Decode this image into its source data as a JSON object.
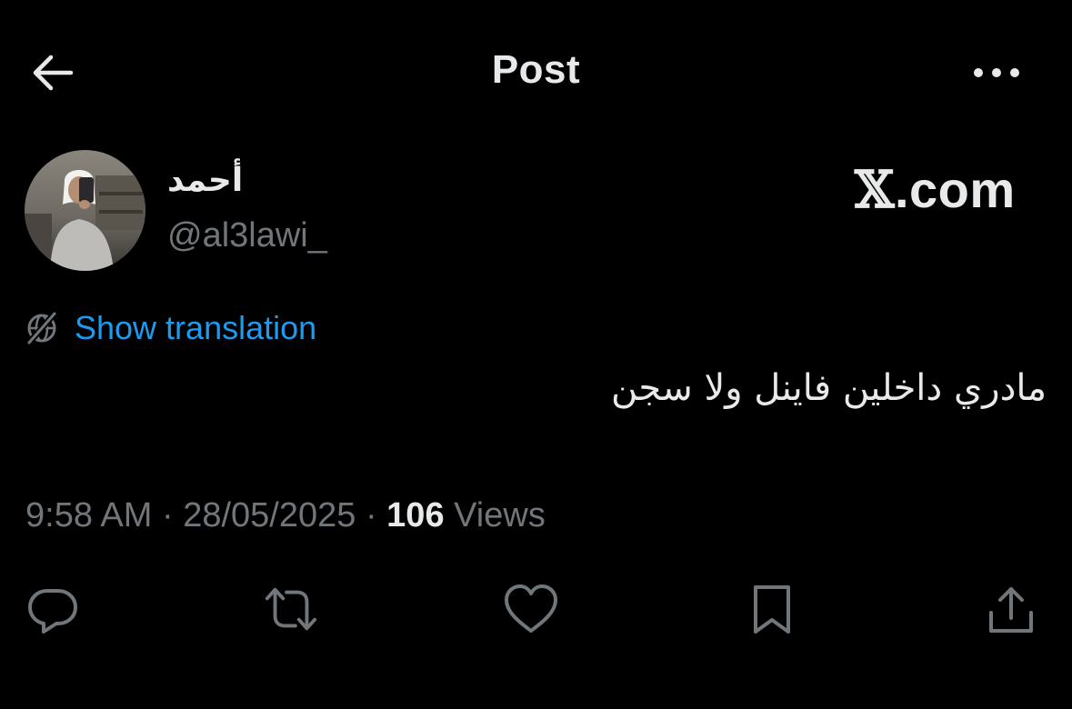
{
  "header": {
    "title": "Post",
    "back_icon": "arrow-left-icon",
    "more_icon": "ellipsis-icon"
  },
  "author": {
    "display_name": "أحمد",
    "handle": "@al3lawi_",
    "avatar": "profile-photo"
  },
  "watermark": {
    "x_letter": "𝕏",
    "domain": ".com"
  },
  "translation": {
    "label": "Show translation",
    "icon": "globe-slash-icon"
  },
  "post": {
    "text": "مادري داخلين فاينل ولا سجن"
  },
  "meta": {
    "time": "9:58 AM",
    "separator": " · ",
    "date": "28/05/2025",
    "views_count": "106",
    "views_label": " Views"
  },
  "actions": [
    {
      "name": "reply",
      "icon": "reply-icon"
    },
    {
      "name": "repost",
      "icon": "repost-icon"
    },
    {
      "name": "like",
      "icon": "heart-icon"
    },
    {
      "name": "bookmark",
      "icon": "bookmark-icon"
    },
    {
      "name": "share",
      "icon": "share-icon"
    }
  ],
  "colors": {
    "background": "#000000",
    "text_primary": "#e7e9ea",
    "text_secondary": "#71767b",
    "accent": "#1d9bf0"
  }
}
